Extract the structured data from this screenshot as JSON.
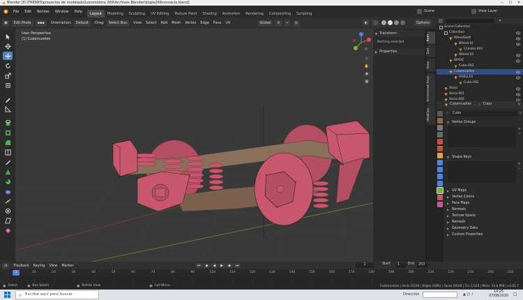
{
  "window": {
    "title": "Blender [D:\\TRENES\\proyectos de modelado\\Locomotora 269\\Archivos Blender\\bogie269convacio.blend]",
    "controls": [
      "—",
      "☐",
      "✕"
    ]
  },
  "menu": [
    "File",
    "Edit",
    "Render",
    "Window",
    "Help"
  ],
  "workspaces": [
    "Layout",
    "Modeling",
    "Sculpting",
    "UV Editing",
    "Texture Paint",
    "Shading",
    "Animation",
    "Rendering",
    "Compositing",
    "Scripting"
  ],
  "workspace_active": 0,
  "scene": {
    "label": "Scene",
    "view_layer": "View Layer"
  },
  "viewport_header": {
    "mode": "Edit Mode",
    "orientation_label": "Orientation:",
    "orientation_value": "Default",
    "drag_label": "Drag:",
    "drag_value": "Select Box",
    "menus": [
      "View",
      "Select",
      "Add",
      "Mesh",
      "Vertex",
      "Edge",
      "Face",
      "UV"
    ],
    "transform_orientation": "Global",
    "options": "Options"
  },
  "viewport": {
    "view_name": "User Perspective",
    "object_name": "(1) Cubemuelles"
  },
  "npanel": {
    "transform_title": "Transform",
    "nothing_selected": "Nothing selected",
    "properties_title": "Properties",
    "tabs": [
      "Item",
      "Tool",
      "View",
      "Screencast Keys",
      "HardOps"
    ]
  },
  "outliner": {
    "rows": [
      {
        "label": "Scene Collection",
        "indent": 0,
        "icon": "collection",
        "eye": false,
        "selected": false
      },
      {
        "label": "Collection",
        "indent": 1,
        "icon": "collection",
        "eye": true,
        "selected": false
      },
      {
        "label": "WheelSet0",
        "indent": 2,
        "icon": "empty",
        "eye": true,
        "selected": false
      },
      {
        "label": "Wheel.01",
        "indent": 3,
        "icon": "mesh",
        "eye": true,
        "selected": false
      },
      {
        "label": "Cilindro.003",
        "indent": 4,
        "icon": "data",
        "eye": false,
        "selected": false
      },
      {
        "label": "Wheel.02",
        "indent": 3,
        "icon": "mesh",
        "eye": true,
        "selected": false
      },
      {
        "label": "BOGIE",
        "indent": 2,
        "icon": "empty",
        "eye": true,
        "selected": false
      },
      {
        "label": "Cubo.003",
        "indent": 3,
        "icon": "data",
        "eye": false,
        "selected": false
      },
      {
        "label": "Cubemuelles",
        "indent": 2,
        "icon": "mesh",
        "eye": true,
        "selected": true
      },
      {
        "label": "HUELLES",
        "indent": 3,
        "icon": "mesh",
        "eye": true,
        "selected": false
      },
      {
        "label": "Cubo.002",
        "indent": 4,
        "icon": "data",
        "eye": false,
        "selected": false
      },
      {
        "label": "Vacio",
        "indent": 1,
        "icon": "empty",
        "eye": true,
        "selected": false
      },
      {
        "label": "Vacio.001",
        "indent": 1,
        "icon": "empty",
        "eye": true,
        "selected": false
      },
      {
        "label": "Vacio.002",
        "indent": 1,
        "icon": "empty",
        "eye": true,
        "selected": false
      }
    ]
  },
  "properties": {
    "breadcrumb_object": "Cubemuelles",
    "breadcrumb_data": "Cubo",
    "data_name": "Cubo",
    "sections_top": [
      "Vertex Groups",
      "Shape Keys"
    ],
    "sections": [
      "UV Maps",
      "Vertex Colors",
      "Face Maps",
      "Normals",
      "Texture Space",
      "Remesh",
      "Geometry Data",
      "Custom Properties"
    ]
  },
  "timeline": {
    "menus": [
      "Playback",
      "Keying",
      "View",
      "Marker"
    ],
    "current_frame": "1",
    "start_label": "Start",
    "start": "1",
    "end_label": "End",
    "end": "250",
    "ticks": [
      "1",
      "10",
      "20",
      "30",
      "40",
      "50",
      "60",
      "70",
      "80",
      "90",
      "100",
      "110",
      "120",
      "130",
      "140",
      "150",
      "160",
      "170",
      "180",
      "190",
      "200",
      "210",
      "220",
      "230",
      "240",
      "250"
    ]
  },
  "statusbar": {
    "select": "Select",
    "box_select": "Box Select",
    "rotate_view": "Rotate View",
    "call_menu": "Call Menu",
    "stats": "Cubemuelles | Verts 0/536 | Edges 0/892 | Faces 0/448 | Tris 1,024 | Mem: 54.8 MiB | v2.82.7"
  },
  "taskbar": {
    "search_placeholder": "Escribe aquí para buscar",
    "address": "Dirección",
    "time": "14:25",
    "date": "07/08/2020"
  },
  "colors": {
    "mesh": "#c8566c",
    "mesh_dark": "#8f3a4c",
    "frame": "#8a6f5a",
    "frame_dark": "#5e4b3d",
    "accent": "#5680c2",
    "selected_row": "#334d80"
  }
}
